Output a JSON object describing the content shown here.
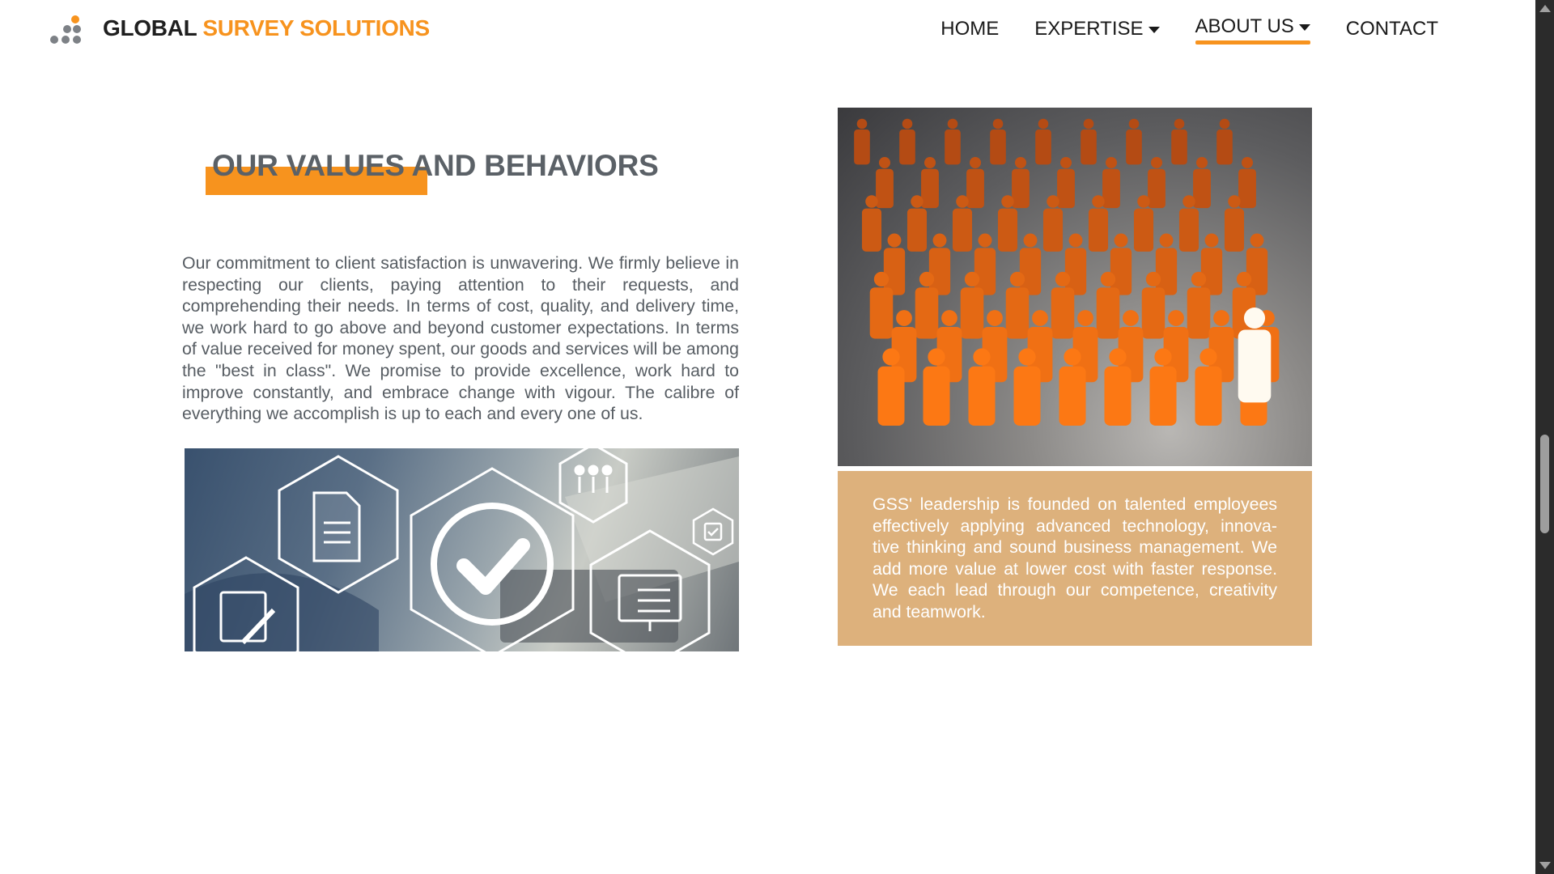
{
  "header": {
    "brand_part1": "GLOBAL",
    "brand_part2": "SURVEY SOLUTIONS",
    "nav": [
      {
        "label": "HOME"
      },
      {
        "label": "EXPERTISE"
      },
      {
        "label": "ABOUT US"
      },
      {
        "label": "CONTACT"
      }
    ],
    "active_nav": "ABOUT US"
  },
  "section": {
    "heading": "OUR VALUES AND BEHAVIORS",
    "paragraph": "Our commitment to client satisfaction is unwavering. We firmly believe in respecting our clients, paying attention to their requests, and comprehending their needs. In terms of cost, quality, and delivery time, we work hard to go above and beyond customer expectations. In terms of value received for money spent, our goods and services will be among the \"best in class\". We promise to provide excellence, work hard to improve constantly, and embrace change with vigour. The calibre of everything we accomplish is up to each and every one of us.",
    "caption": "GSS' leadership is founded on talented employees effectively applying advanced technology, innova- tive thinking and sound business management. We add more value at lower cost with faster response. We each lead through our competence, creativity and teamwork."
  },
  "colors": {
    "accent": "#f7931e",
    "caption_bg": "#ddb17c",
    "text": "#575d63"
  },
  "icons": [
    "logo-dots-icon",
    "caret-down-icon",
    "document-icon",
    "checkmark-icon",
    "people-icon",
    "notepad-icon",
    "monitor-checklist-icon",
    "clipboard-icon"
  ]
}
